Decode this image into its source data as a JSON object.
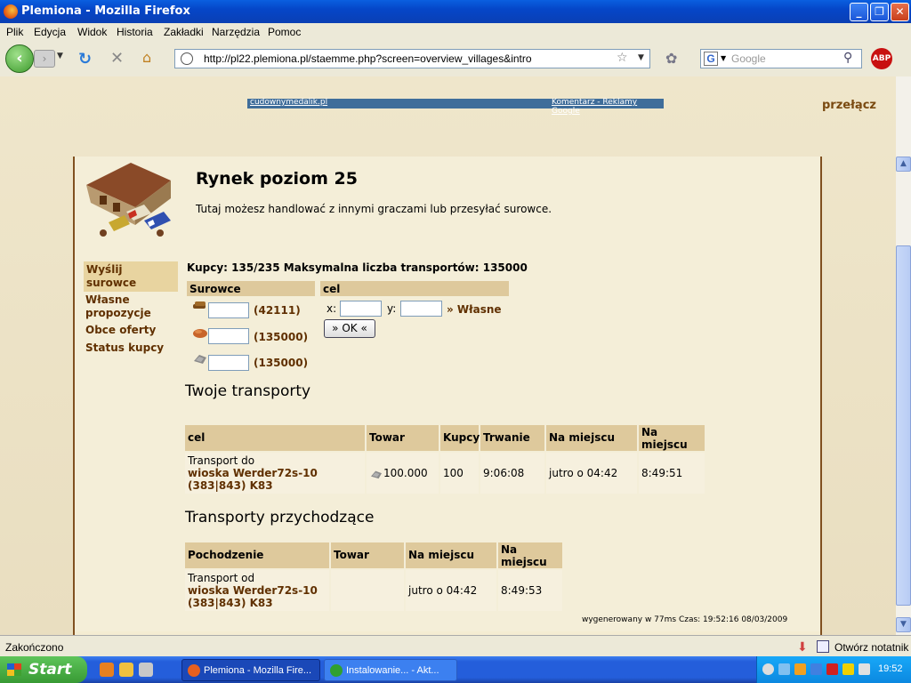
{
  "window": {
    "title": "Plemiona - Mozilla Firefox",
    "minimize": "_",
    "maximize": "❐",
    "close": "✕"
  },
  "menu": [
    "Plik",
    "Edycja",
    "Widok",
    "Historia",
    "Zakładki",
    "Narzędzia",
    "Pomoc"
  ],
  "nav": {
    "url": "http://pl22.plemiona.pl/staemme.php?screen=overview_villages&intro",
    "search_placeholder": "Google",
    "abp": "ABP"
  },
  "ad": {
    "left": "cudownymedalik.pl",
    "right": "Komentarz - Reklamy Google"
  },
  "switch_label": "przełącz",
  "page": {
    "title": "Rynek poziom 25",
    "description": "Tutaj możesz handlować z innymi graczami lub przesyłać surowce."
  },
  "sidemenu": [
    "Wyślij surowce",
    "Własne propozycje",
    "Obce oferty",
    "Status kupcy"
  ],
  "traders_info": "Kupcy: 135/235 Maksymalna liczba transportów: 135000",
  "send_form": {
    "resources_header": "Surowce",
    "target_header": "cel",
    "resources": [
      {
        "icon": "wood-icon",
        "value": "(42111)"
      },
      {
        "icon": "clay-icon",
        "value": "(135000)"
      },
      {
        "icon": "iron-icon",
        "value": "(135000)"
      }
    ],
    "x_label": "x:",
    "y_label": "y:",
    "own_link": "» Własne",
    "ok_label": "» OK «"
  },
  "outgoing": {
    "title": "Twoje transporty",
    "headers": [
      "cel",
      "Towar",
      "Kupcy",
      "Trwanie",
      "Na miejscu",
      "Na miejscu za"
    ],
    "row": {
      "prefix": "Transport do",
      "village": "wioska Werder72s-10",
      "coords": "(383|843) K83",
      "goods": "100.000",
      "traders": "100",
      "duration": "9:06:08",
      "arrival": "jutro o 04:42",
      "eta": "8:49:51"
    }
  },
  "incoming": {
    "title": "Transporty przychodzące",
    "headers": [
      "Pochodzenie",
      "Towar",
      "Na miejscu",
      "Na miejscu za"
    ],
    "row": {
      "prefix": "Transport od",
      "village": "wioska Werder72s-10",
      "coords": "(383|843) K83",
      "goods": "",
      "arrival": "jutro o 04:42",
      "eta": "8:49:53"
    }
  },
  "footer": "wygenerowany w 77ms Czas: 19:52:16 08/03/2009",
  "statusbar": {
    "text": "Zakończono",
    "notes": "Otwórz notatnik"
  },
  "taskbar": {
    "start": "Start",
    "tasks": [
      "Plemiona - Mozilla Fire...",
      "Instalowanie... - Akt..."
    ],
    "clock": "19:52"
  }
}
